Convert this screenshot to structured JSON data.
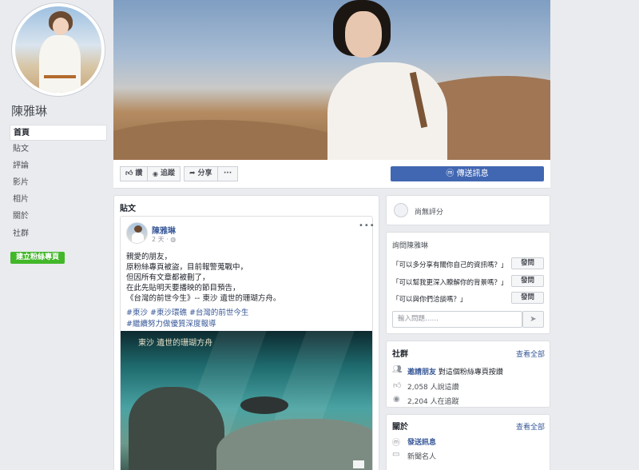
{
  "sidebar": {
    "page_name": "陳雅琳",
    "items": [
      {
        "label": "首頁"
      },
      {
        "label": "貼文"
      },
      {
        "label": "評論"
      },
      {
        "label": "影片"
      },
      {
        "label": "相片"
      },
      {
        "label": "關於"
      },
      {
        "label": "社群"
      }
    ],
    "create_page_label": "建立粉絲專頁"
  },
  "actions": {
    "like_label": "讚",
    "follow_label": "追蹤",
    "share_label": "分享",
    "more_label": "···",
    "send_message_label": "傳送訊息"
  },
  "posts_section": {
    "title": "貼文",
    "post": {
      "author": "陳雅琳",
      "time": "2 天 ·",
      "lines": [
        "親愛的朋友，",
        "原粉絲專頁被盜，目前報警蒐戰中，",
        "但因所有文章都被刪了，",
        "在此先貼明天要播映的節目預告，",
        "《台灣的前世今生》-- 東沙 遺世的珊瑚方舟。"
      ],
      "tags_line1": "#東沙 #東沙環礁 #台灣的前世今生",
      "tags_line2": "#繼續努力做優質深度報導",
      "video_caption": "東沙 遺世的珊瑚方舟"
    }
  },
  "rating": {
    "text": "尚無評分"
  },
  "ask": {
    "title": "詢問陳雅琳",
    "questions": [
      {
        "text": "「可以多分享有關你自己的資訊嗎？」",
        "button": "發問"
      },
      {
        "text": "「可以幫我更深入瞭解你的背景嗎？」",
        "button": "發問"
      },
      {
        "text": "「可以與你們洽談嗎？」",
        "button": "發問"
      }
    ],
    "input_placeholder": "輸入問題……"
  },
  "community": {
    "title": "社群",
    "see_all": "查看全部",
    "invite_link": "邀請朋友",
    "invite_text": "對這個粉絲專頁按讚",
    "likes_text": "2,058 人說這讚",
    "follows_text": "2,204 人在追蹤"
  },
  "about": {
    "title": "關於",
    "see_all": "查看全部",
    "send_message": "發送訊息",
    "category": "新聞名人"
  }
}
